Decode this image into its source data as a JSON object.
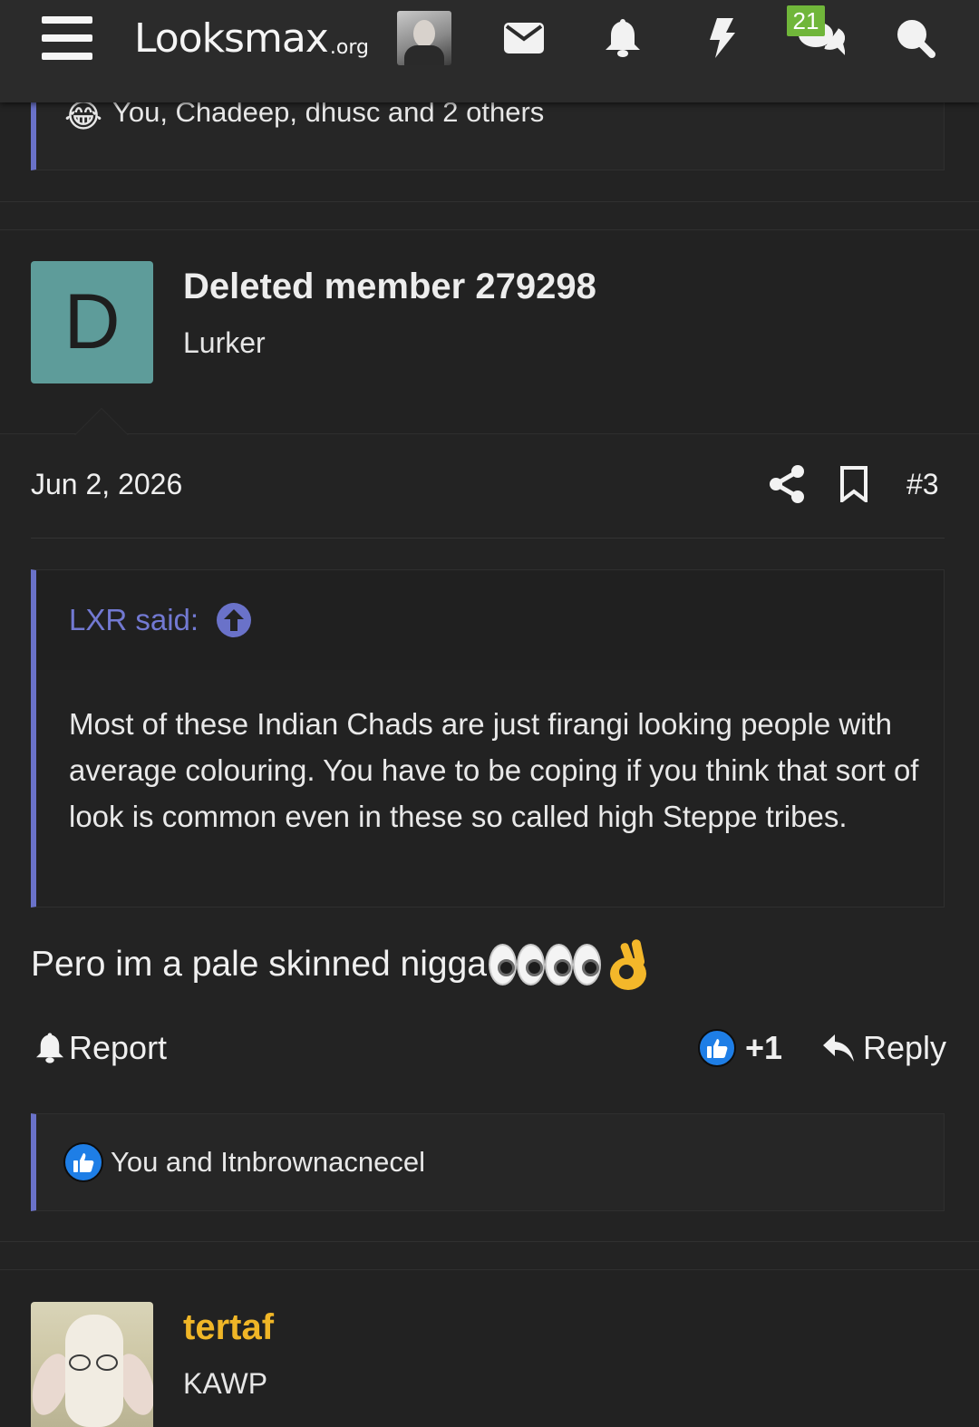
{
  "header": {
    "logo_text": "Looksmax",
    "logo_suffix": ".org",
    "conversations_badge": "21",
    "icons": [
      "menu-icon",
      "envelope-icon",
      "bell-icon",
      "bolt-icon",
      "conversations-icon",
      "search-icon"
    ]
  },
  "prev_post": {
    "reactions_text": "You, Chadeep, dhusc and 2 others",
    "reaction_emoji": "😂"
  },
  "post": {
    "author_initial": "D",
    "author_name": "Deleted member 279298",
    "author_title": "Lurker",
    "date": "Jun 2, 2026",
    "post_number": "#3",
    "quote": {
      "author": "LXR said:",
      "text": "Most of these Indian Chads are just firangi looking people with average colouring. You have to be coping if you think that sort of look is common even in these so called high Steppe tribes."
    },
    "message": "Pero im a pale skinned nigga",
    "actions": {
      "report": "Report",
      "like_count": "+1",
      "reply": "Reply"
    },
    "reactions_text": "You and Itnbrownacnecel"
  },
  "next_post": {
    "author_name": "tertaf",
    "author_title": "KAWP"
  },
  "colors": {
    "background": "#232323",
    "accent": "#6a72c9",
    "like_blue": "#1e7ee6",
    "badge_green": "#70b63a",
    "username_orange": "#f0b627"
  }
}
